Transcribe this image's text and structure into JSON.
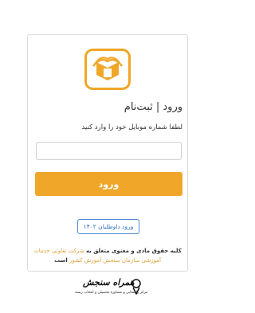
{
  "header": {
    "title": "ورود | ثبت‌نام",
    "prompt": "لطفا شماره موبایل خود را وارد کنید"
  },
  "form": {
    "phone_value": "",
    "phone_placeholder": "",
    "login_label": "ورود",
    "volunteer_label": "ورود داوطلبان ۱۴۰۲"
  },
  "footer": {
    "copyright_prefix": "کلیه حقوق مادی و معنوی متعلق به",
    "copyright_link": "شرکت تعاونی خدمات آموزشی سازمان سنجش آموزش کشور",
    "copyright_suffix": "است"
  },
  "brand": {
    "name": "همراه سنجش",
    "sub": "مرکز راهنمایی و مشاوره تحصیلی و انتخاب رشته"
  },
  "colors": {
    "accent": "#f0a628",
    "link": "#2f6fc4",
    "border": "#dcdcdc"
  },
  "icons": {
    "logo": "book-logo-icon",
    "brand": "brand-emblem-icon"
  }
}
